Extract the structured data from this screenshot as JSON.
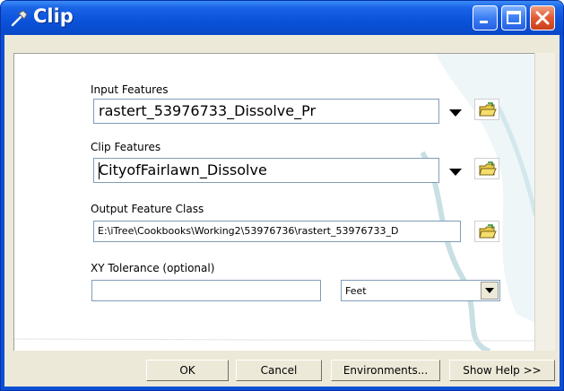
{
  "window": {
    "title": "Clip",
    "icon": "hammer-icon",
    "controls": {
      "minimize": "minimize-icon",
      "maximize": "maximize-icon",
      "close": "close-icon"
    }
  },
  "form": {
    "input_features": {
      "label": "Input Features",
      "value": "rastert_53976733_Dissolve_Pr"
    },
    "clip_features": {
      "label": "Clip Features",
      "value": "CityofFairlawn_Dissolve"
    },
    "output_feature_class": {
      "label": "Output Feature Class",
      "value": "E:\\iTree\\Cookbooks\\Working2\\53976736\\rastert_53976733_D"
    },
    "xy_tolerance": {
      "label": "XY Tolerance (optional)",
      "value": "",
      "unit": "Feet"
    }
  },
  "buttons": {
    "ok": "OK",
    "cancel": "Cancel",
    "environments": "Environments...",
    "show_help": "Show Help >>"
  },
  "colors": {
    "titlebar": "#0a52d9",
    "close_button": "#e05a34",
    "dialog_bg": "#ece9d8"
  }
}
